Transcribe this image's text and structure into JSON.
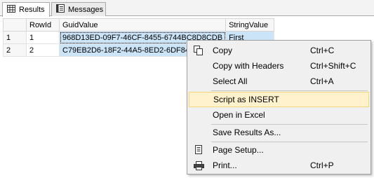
{
  "tabs": [
    {
      "label": "Results",
      "icon": "grid-icon"
    },
    {
      "label": "Messages",
      "icon": "messages-icon"
    }
  ],
  "grid": {
    "columns": [
      "RowId",
      "GuidValue",
      "StringValue"
    ],
    "rows": [
      {
        "num": "1",
        "RowId": "1",
        "GuidValue": "968D13ED-09F7-46CF-8455-6744BC8D8CDB",
        "StringValue": "First"
      },
      {
        "num": "2",
        "RowId": "2",
        "GuidValue": "C79EB2D6-18F2-44A5-8ED2-6DF84",
        "StringValue": ""
      }
    ]
  },
  "menu": {
    "items": [
      {
        "label": "Copy",
        "shortcut": "Ctrl+C",
        "icon": "copy-icon"
      },
      {
        "label": "Copy with Headers",
        "shortcut": "Ctrl+Shift+C",
        "icon": ""
      },
      {
        "label": "Select All",
        "shortcut": "Ctrl+A",
        "icon": ""
      },
      {
        "label": "Script as INSERT",
        "shortcut": "",
        "icon": "",
        "highlighted": true
      },
      {
        "label": "Open in Excel",
        "shortcut": "",
        "icon": ""
      },
      {
        "label": "Save Results As...",
        "shortcut": "",
        "icon": ""
      },
      {
        "label": "Page Setup...",
        "shortcut": "",
        "icon": "page-setup-icon"
      },
      {
        "label": "Print...",
        "shortcut": "Ctrl+P",
        "icon": "printer-icon"
      }
    ]
  },
  "colors": {
    "selection": "#cce4f7",
    "highlight": "#fff2cc"
  }
}
